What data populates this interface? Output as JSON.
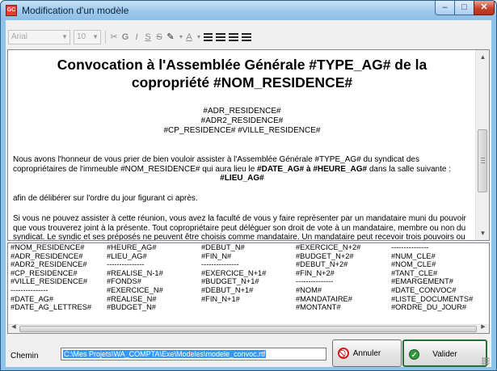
{
  "window": {
    "title": "Modification d'un modèle",
    "icon_label": "GC",
    "controls": {
      "minimize": "–",
      "maximize": "□",
      "close": "✕"
    }
  },
  "toolbar": {
    "font_name": "Arial",
    "font_size": "10",
    "buttons": {
      "cut": "✂",
      "bold": "G",
      "italic": "I",
      "underline": "S",
      "strike": "S",
      "highlight": "✎",
      "font_color": "A"
    }
  },
  "document": {
    "title_line1": "Convocation à l'Assemblée Générale #TYPE_AG# de la",
    "title_line2": "copropriété #NOM_RESIDENCE#",
    "address": [
      "#ADR_RESIDENCE#",
      "#ADR2_RESIDENCE#",
      "#CP_RESIDENCE# #VILLE_RESIDENCE#"
    ],
    "para1_start": "Nous avons l'honneur de vous prier de bien vouloir assister à l'Assemblée Générale #TYPE_AG# du syndicat des copropriétaires de l'immeuble #NOM_RESIDENCE# qui aura lieu le ",
    "para1_date": "#DATE_AG#",
    "para1_mid": " à ",
    "para1_hour": "#HEURE_AG#",
    "para1_end": " dans la salle suivante :",
    "lieu": "#LIEU_AG#",
    "para2": "afin de délibérer sur l'ordre du jour figurant ci après.",
    "para3": "Si vous ne pouvez assister à cette réunion, vous avez la faculté de vous y faire représenter par un mandataire muni du pouvoir que vous trouverez joint à la présente. Tout copropriétaire peut déléguer son droit de vote à un mandataire, membre ou non du syndicat. Le syndic et ses préposés ne peuvent être choisis comme mandataire. Un mandataire peut recevoir trois pouvoirs ou plus."
  },
  "fields": [
    [
      "#NOM_RESIDENCE#",
      "#HEURE_AG#",
      "#DEBUT_N#",
      "#EXERCICE_N+2#",
      "---------------"
    ],
    [
      "#ADR_RESIDENCE#",
      "#LIEU_AG#",
      "#FIN_N#",
      "#BUDGET_N+2#",
      "#NUM_CLE#"
    ],
    [
      "#ADR2_RESIDENCE#",
      "---------------",
      "---------------",
      "#DEBUT_N+2#",
      "#NOM_CLE#"
    ],
    [
      "#CP_RESIDENCE#",
      "#REALISE_N-1#",
      "#EXERCICE_N+1#",
      "#FIN_N+2#",
      "#TANT_CLE#"
    ],
    [
      "#VILLE_RESIDENCE#",
      "#FONDS#",
      "#BUDGET_N+1#",
      "---------------",
      "#EMARGEMENT#"
    ],
    [
      "---------------",
      "#EXERCICE_N#",
      "#DEBUT_N+1#",
      "#NOM#",
      "#DATE_CONVOC#"
    ],
    [
      "#DATE_AG#",
      "#REALISE_N#",
      "#FIN_N+1#",
      "#MANDATAIRE#",
      "#LISTE_DOCUMENTS#"
    ],
    [
      "#DATE_AG_LETTRES#",
      "#BUDGET_N#",
      "",
      "#MONTANT#",
      "#ORDRE_DU_JOUR#"
    ]
  ],
  "bottom": {
    "chemin_label": "Chemin",
    "chemin_value": "C:\\Mes Projets\\WA_COMPTA\\Exe\\Modeles\\modele_convoc.rtf",
    "annuler_label": "Annuler",
    "valider_label": "Valider"
  },
  "colors": {
    "titlebar": "#9cc8ea",
    "selection": "#3399ff",
    "cancel_icon": "#d21c1c",
    "ok_icon": "#2f9a3a"
  }
}
